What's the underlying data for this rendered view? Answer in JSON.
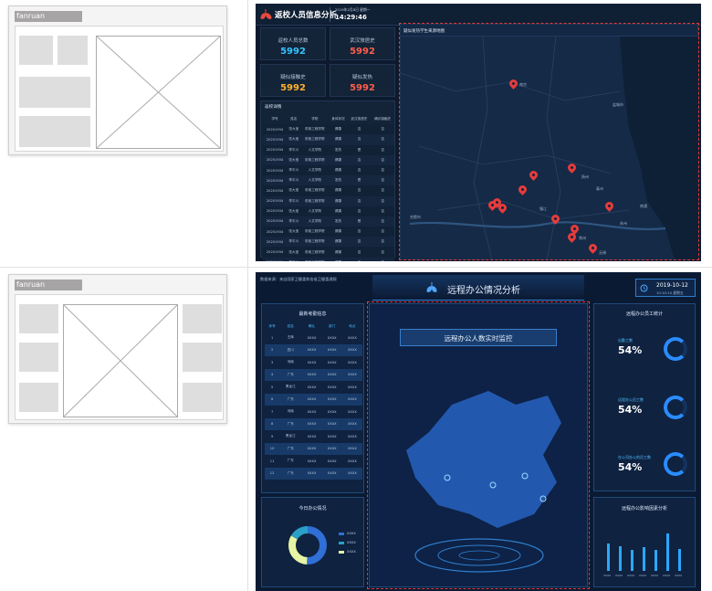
{
  "wireframe1": {
    "title": "fanruan"
  },
  "wireframe2": {
    "title": "fanruan"
  },
  "dash1": {
    "title": "返校人员信息分析",
    "date": "2019年2月8日 星期一",
    "time": "14:29:46",
    "kpis": [
      {
        "label": "返校人员总数",
        "value": "5992",
        "color": "#35c4ff"
      },
      {
        "label": "武汉旅居史",
        "value": "5992",
        "color": "#ff5d4d"
      },
      {
        "label": "疑似接触史",
        "value": "5992",
        "color": "#ffb02e"
      },
      {
        "label": "疑似发热",
        "value": "5992",
        "color": "#ff5d4d"
      }
    ],
    "table_title": "返校详情",
    "columns": [
      "学号",
      "姓名",
      "学院",
      "身体状况",
      "武汉旅居史",
      "确诊接触史"
    ],
    "rows": [
      [
        "20201934",
        "张大宝",
        "机电工程学院",
        "健康",
        "否",
        "否"
      ],
      [
        "20201934",
        "张大宝",
        "机电工程学院",
        "健康",
        "否",
        "否"
      ],
      [
        "20201934",
        "李平川",
        "人文学院",
        "发热",
        "是",
        "否"
      ],
      [
        "20201934",
        "张大宝",
        "机电工程学院",
        "健康",
        "否",
        "否"
      ],
      [
        "20201934",
        "李平川",
        "人文学院",
        "健康",
        "否",
        "否"
      ],
      [
        "20201934",
        "李平川",
        "人文学院",
        "发热",
        "是",
        "否"
      ],
      [
        "20201934",
        "张大宝",
        "机电工程学院",
        "健康",
        "否",
        "否"
      ],
      [
        "20201934",
        "李平川",
        "机电工程学院",
        "健康",
        "否",
        "否"
      ],
      [
        "20201934",
        "张大宝",
        "人文学院",
        "健康",
        "否",
        "否"
      ],
      [
        "20201934",
        "李平川",
        "人文学院",
        "发热",
        "是",
        "否"
      ],
      [
        "20201934",
        "张大宝",
        "机电工程学院",
        "健康",
        "否",
        "否"
      ],
      [
        "20201934",
        "李平川",
        "机电工程学院",
        "健康",
        "否",
        "否"
      ],
      [
        "20201934",
        "张大宝",
        "机电工程学院",
        "健康",
        "否",
        "否"
      ],
      [
        "20201934",
        "李平川",
        "机电工程学院",
        "健康",
        "否",
        "否"
      ]
    ],
    "map_title": "疑似发热学生来源地图",
    "cities": [
      "南京",
      "合肥市",
      "扬州",
      "盐城市",
      "泰州",
      "苏州",
      "常州",
      "无锡",
      "镇江",
      "南通"
    ]
  },
  "dash2": {
    "source": "数据来源：来自国家卫健委和各省卫健委通报",
    "title": "远程办公情况分析",
    "date": "2019-10-12",
    "time": "10:10:10 星期五",
    "attendance_title": "最新考勤信息",
    "att_columns": [
      "序号",
      "姓名",
      "确认",
      "部门",
      "地点"
    ],
    "att_rows": [
      [
        "1",
        "王辉",
        "XXXX",
        "XXXX",
        "XXXX"
      ],
      [
        "2",
        "四川",
        "XXXX",
        "XXXX",
        "XXXX"
      ],
      [
        "3",
        "河南",
        "XXXX",
        "XXXX",
        "XXXX"
      ],
      [
        "4",
        "广东",
        "XXXX",
        "XXXX",
        "XXXX"
      ],
      [
        "5",
        "黑龙江",
        "XXXX",
        "XXXX",
        "XXXX"
      ],
      [
        "6",
        "广东",
        "XXXX",
        "XXXX",
        "XXXX"
      ],
      [
        "7",
        "河南",
        "XXXX",
        "XXXX",
        "XXXX"
      ],
      [
        "8",
        "广东",
        "XXXX",
        "XXXX",
        "XXXX"
      ],
      [
        "9",
        "黑龙江",
        "XXXX",
        "XXXX",
        "XXXX"
      ],
      [
        "10",
        "广东",
        "XXXX",
        "XXXX",
        "XXXX"
      ],
      [
        "11",
        "广东",
        "XXXX",
        "XXXX",
        "XXXX"
      ],
      [
        "12",
        "广东",
        "XXXX",
        "XXXX",
        "XXXX"
      ]
    ],
    "today_title": "今日办公情况",
    "legend": [
      "XXXX",
      "XXXX",
      "XXXX"
    ],
    "center_title": "远程办公人数实时监控",
    "stats_title": "远程办公员工统计",
    "stats": [
      {
        "label": "出勤工数",
        "value": "54%"
      },
      {
        "label": "远程办公员工数",
        "value": "54%"
      },
      {
        "label": "在公司办公的员工数",
        "value": "54%"
      }
    ],
    "bars_title": "远程办公影响因素分析",
    "bar_values": [
      0.55,
      0.5,
      0.42,
      0.48,
      0.42,
      0.75,
      0.45
    ],
    "bar_labels": [
      "XXXX",
      "XXXX",
      "XXXX",
      "XXXX",
      "XXXX",
      "XXXX",
      "XXXX"
    ]
  }
}
